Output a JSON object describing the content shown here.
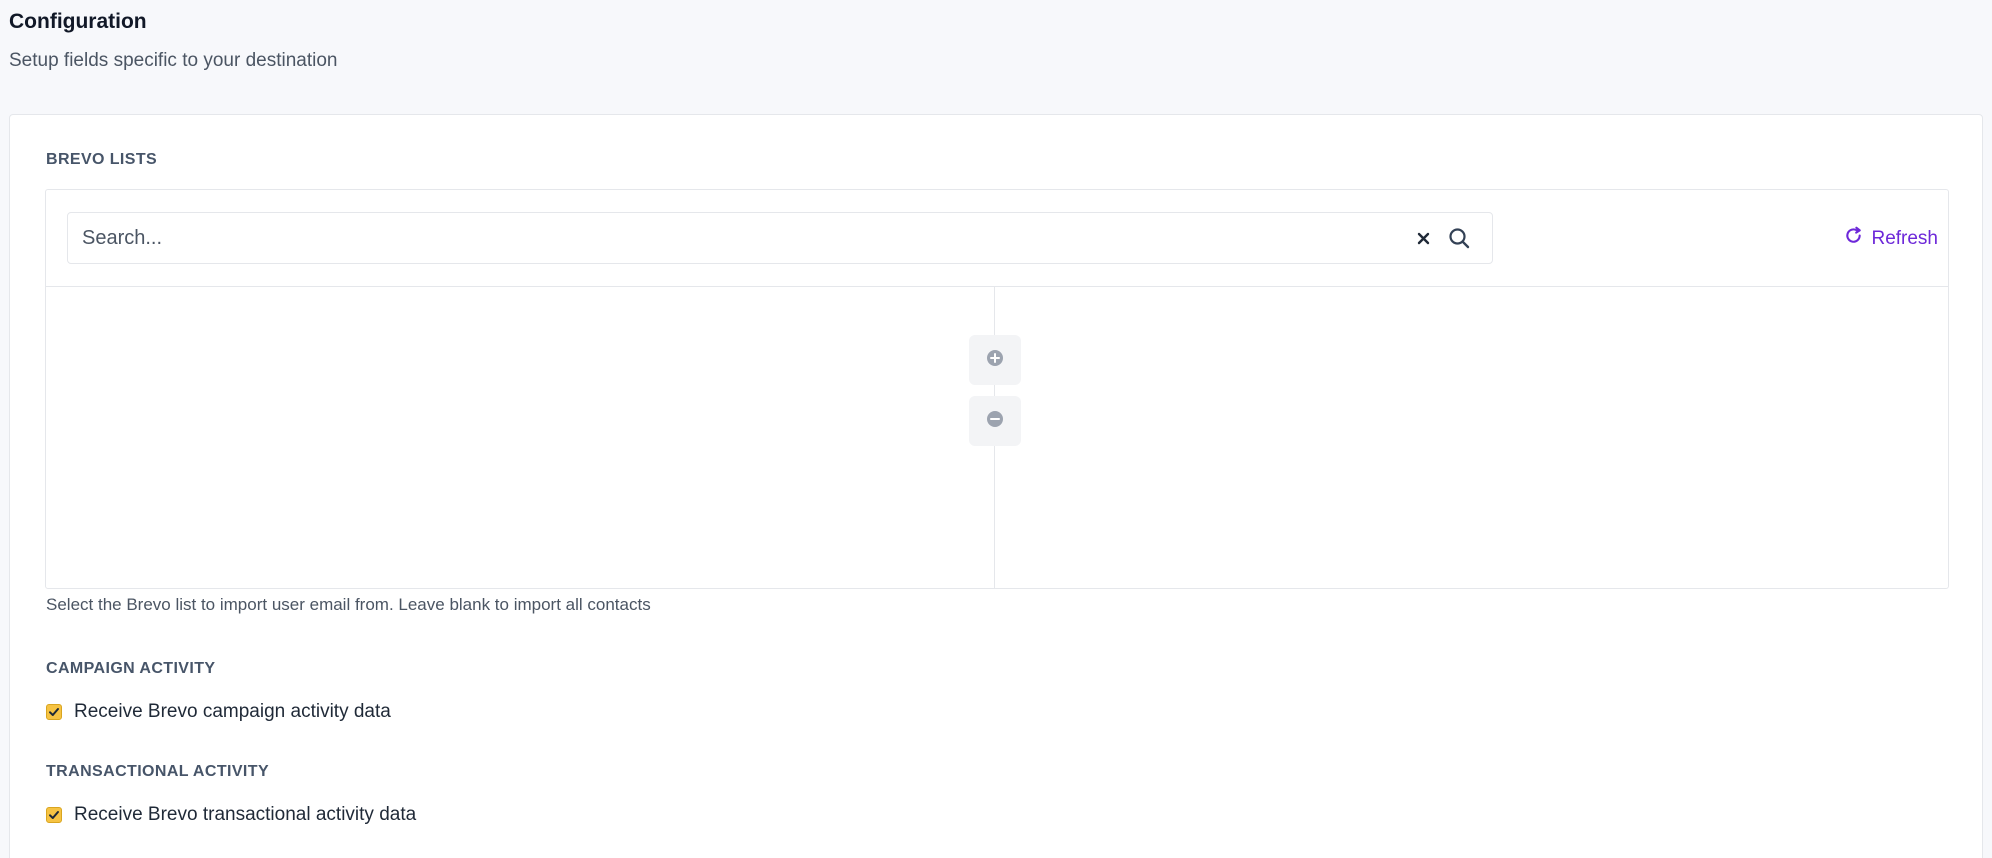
{
  "header": {
    "title": "Configuration",
    "subtitle": "Setup fields specific to your destination"
  },
  "brevo_lists": {
    "label": "BREVO LISTS",
    "search": {
      "placeholder": "Search...",
      "value": ""
    },
    "clear_icon": "close-icon",
    "search_icon": "search-icon",
    "refresh_label": "Refresh",
    "refresh_icon": "refresh-icon",
    "add_icon": "plus-circle-icon",
    "remove_icon": "minus-circle-icon",
    "help": "Select the Brevo list to import user email from. Leave blank to import all contacts"
  },
  "campaign_activity": {
    "label": "CAMPAIGN ACTIVITY",
    "checkbox_label": "Receive Brevo campaign activity data",
    "checked": true
  },
  "transactional_activity": {
    "label": "TRANSACTIONAL ACTIVITY",
    "checkbox_label": "Receive Brevo transactional activity data",
    "checked": true
  },
  "colors": {
    "accent": "#6d28d9",
    "checkbox": "#f6c343",
    "border": "#e5e7eb",
    "page_bg": "#f7f8fb"
  }
}
